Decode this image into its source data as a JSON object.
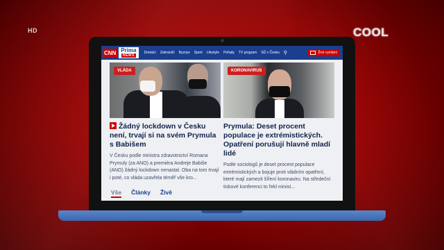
{
  "overlay": {
    "hd_badge": "HD",
    "channel_logo": "COOL"
  },
  "site": {
    "logo_cnn": "CNN",
    "logo_prima": "Prima",
    "logo_news": "NEWS",
    "nav": [
      "Domácí",
      "Zahraničí",
      "Byznys",
      "Sport",
      "Lifestyle",
      "Pořady",
      "TV program",
      "SŮ v Česku"
    ],
    "live_button": "Živé vysílání"
  },
  "articles": [
    {
      "tag": "VLÁDA",
      "headline": "Žádný lockdown v Česku není, trvají si na svém Prymula s Babišem",
      "perex": "V Česku podle ministra zdravotnictví Romana Prymuly (za ANO) a premiéra Andreje Babiše (ANO) žádný lockdown nenastal. Oba na tom trvají i poté, co vláda uzavřela téměř vše kro..."
    },
    {
      "tag": "KORONAVIRUS",
      "headline": "Prymula: Deset procent populace je extrémistických. Opatření porušují hlavně mladí lidé",
      "perex": "Podle sociologů je deset procent populace extrémistických a bojuje proti vládním opatření, které mají zamezit šíření koronaviru. Na středeční tiskové konferenci to řekl minist..."
    }
  ],
  "tabs": [
    "Vše",
    "Články",
    "Živě"
  ]
}
